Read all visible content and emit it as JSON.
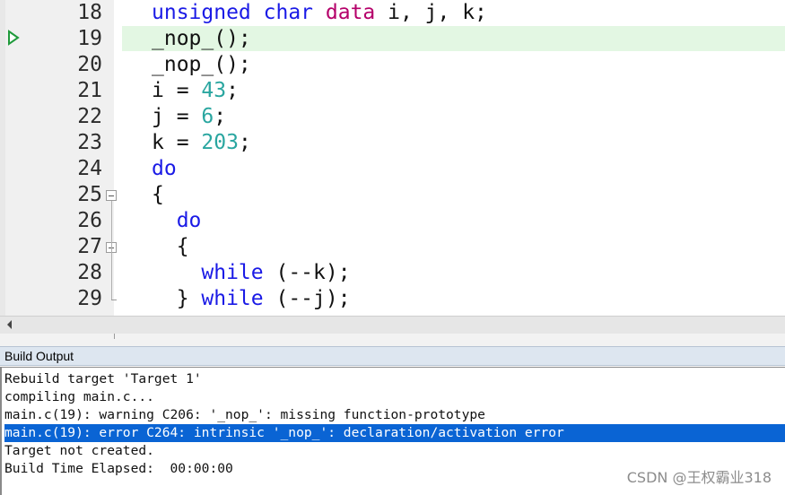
{
  "editor": {
    "lines": [
      {
        "num": "18",
        "tokens": [
          {
            "t": "unsigned",
            "c": "kw"
          },
          {
            "t": " "
          },
          {
            "t": "char",
            "c": "kw"
          },
          {
            "t": " "
          },
          {
            "t": "data",
            "c": "type"
          },
          {
            "t": " i, j, k;"
          }
        ]
      },
      {
        "num": "19",
        "current": true,
        "tokens": [
          {
            "t": "_nop_();"
          }
        ]
      },
      {
        "num": "20",
        "tokens": [
          {
            "t": "_nop_();"
          }
        ]
      },
      {
        "num": "21",
        "tokens": [
          {
            "t": "i = "
          },
          {
            "t": "43",
            "c": "num"
          },
          {
            "t": ";"
          }
        ]
      },
      {
        "num": "22",
        "tokens": [
          {
            "t": "j = "
          },
          {
            "t": "6",
            "c": "num"
          },
          {
            "t": ";"
          }
        ]
      },
      {
        "num": "23",
        "tokens": [
          {
            "t": "k = "
          },
          {
            "t": "203",
            "c": "num"
          },
          {
            "t": ";"
          }
        ]
      },
      {
        "num": "24",
        "tokens": [
          {
            "t": "do",
            "c": "kw"
          }
        ]
      },
      {
        "num": "25",
        "fold": "open",
        "tokens": [
          {
            "t": "{"
          }
        ]
      },
      {
        "num": "26",
        "tokens": [
          {
            "t": "  "
          },
          {
            "t": "do",
            "c": "kw"
          }
        ]
      },
      {
        "num": "27",
        "fold": "open",
        "tokens": [
          {
            "t": "  {"
          }
        ]
      },
      {
        "num": "28",
        "tokens": [
          {
            "t": "    "
          },
          {
            "t": "while",
            "c": "kw"
          },
          {
            "t": " (--k);"
          }
        ]
      },
      {
        "num": "29",
        "fold": "end",
        "tokens": [
          {
            "t": "  } "
          },
          {
            "t": "while",
            "c": "kw"
          },
          {
            "t": " (--j);"
          }
        ]
      }
    ]
  },
  "colors": {
    "keyword": "#1a1ae6",
    "number": "#2aa6a0",
    "type_keyword": "#b5006a",
    "current_line": "#e3f7e3",
    "selection": "#0a64d4"
  },
  "build_output": {
    "title": "Build Output",
    "lines": [
      "Rebuild target 'Target 1'",
      "compiling main.c...",
      "main.c(19): warning C206: '_nop_': missing function-prototype",
      "main.c(19): error C264: intrinsic '_nop_': declaration/activation error",
      "Target not created.",
      "Build Time Elapsed:  00:00:00"
    ],
    "selected_index": 3
  },
  "watermark": "CSDN @王权霸业318",
  "icons": {
    "current_line_marker": "triangle-right-icon",
    "scroll_left": "chevron-left-icon",
    "fold": "collapse-box-icon"
  }
}
